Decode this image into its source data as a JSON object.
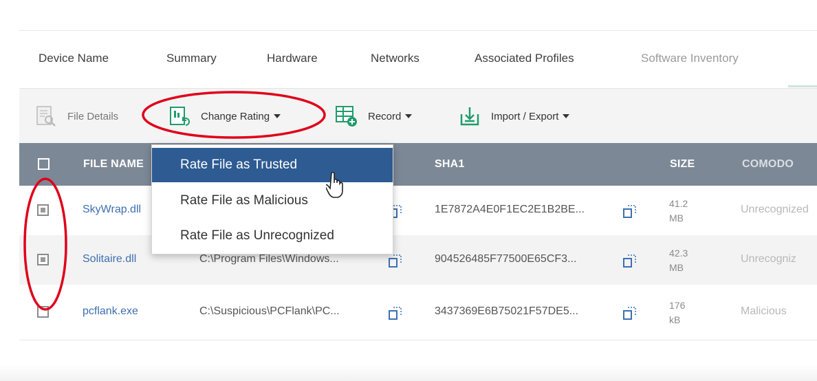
{
  "tabs": [
    "Device Name",
    "Summary",
    "Hardware",
    "Networks",
    "Associated Profiles",
    "Software Inventory"
  ],
  "toolbar": {
    "file_details": "File Details",
    "change_rating": "Change Rating",
    "record": "Record",
    "import_export": "Import / Export"
  },
  "columns": {
    "file_name": "FILE NAME",
    "sha1": "SHA1",
    "size": "SIZE",
    "comodo": "COMODO"
  },
  "dropdown": {
    "items": [
      "Rate File as Trusted",
      "Rate File as Malicious",
      "Rate File as Unrecognized"
    ]
  },
  "rows": [
    {
      "name": "SkyWrap.dll",
      "path": "",
      "sha1": "1E7872A4E0F1EC2E1B2BE...",
      "size_num": "41.2",
      "size_unit": "MB",
      "rating": "Unrecognized",
      "checked": true
    },
    {
      "name": "Solitaire.dll",
      "path": "C:\\Program Files\\Windows...",
      "sha1": "904526485F77500E65CF3...",
      "size_num": "42.3",
      "size_unit": "MB",
      "rating": "Unrecogniz",
      "checked": true
    },
    {
      "name": "pcflank.exe",
      "path": "C:\\Suspicious\\PCFlank\\PC...",
      "sha1": "3437369E6B75021F57DE5...",
      "size_num": "176",
      "size_unit": "kB",
      "rating": "Malicious",
      "checked": false
    }
  ],
  "colors": {
    "header_bg": "#7d8896",
    "dropdown_active": "#2e5b92",
    "annotation": "#e0001a",
    "link": "#3d6fb0"
  }
}
